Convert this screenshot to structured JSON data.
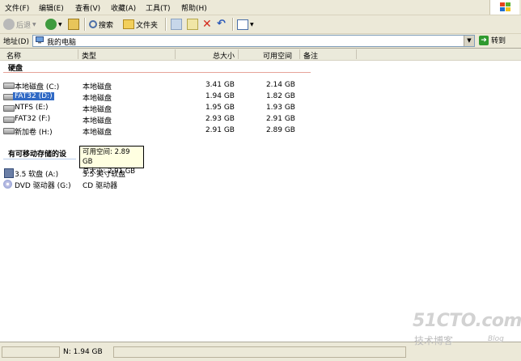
{
  "menubar": {
    "items": [
      "文件(F)",
      "编辑(E)",
      "查看(V)",
      "收藏(A)",
      "工具(T)",
      "帮助(H)"
    ]
  },
  "toolbar": {
    "back_label": "后退",
    "search_label": "搜索",
    "folders_label": "文件夹"
  },
  "address": {
    "label": "地址(D)",
    "value": "我的电脑",
    "go_label": "转到"
  },
  "columns": [
    "名称",
    "类型",
    "总大小",
    "可用空间",
    "备注"
  ],
  "groups": {
    "hard_disks": "硬盘",
    "removable": "有可移动存储的设"
  },
  "hard_disks": [
    {
      "name": "本地磁盘 (C:)",
      "type": "本地磁盘",
      "size": "3.41 GB",
      "free": "2.14 GB"
    },
    {
      "name": "FAT32 (D:)",
      "type": "本地磁盘",
      "size": "1.94 GB",
      "free": "1.82 GB",
      "selected": true
    },
    {
      "name": "NTFS (E:)",
      "type": "本地磁盘",
      "size": "1.95 GB",
      "free": "1.93 GB"
    },
    {
      "name": "FAT32 (F:)",
      "type": "本地磁盘",
      "size": "2.93 GB",
      "free": "2.91 GB"
    },
    {
      "name": "新加卷 (H:)",
      "type": "本地磁盘",
      "size": "2.91 GB",
      "free": "2.89 GB"
    }
  ],
  "removable_drives": [
    {
      "name": "3.5 软盘 (A:)",
      "type": "3.5 英寸软盘",
      "icon": "floppy-icon"
    },
    {
      "name": "DVD 驱动器 (G:)",
      "type": "CD 驱动器",
      "icon": "dvd-drive-icon"
    }
  ],
  "tooltip": {
    "line1": "可用空间: 2.89 GB",
    "line2": "总大小: 2.91 GB"
  },
  "statusbar": {
    "text": "N: 1.94 GB"
  },
  "watermark": {
    "logo": "51CTO.com",
    "sub": "技术博客",
    "blog": "Blog"
  },
  "colors": {
    "chrome": "#ece9d8",
    "selection": "#316ac5",
    "tooltip_bg": "#ffffe1"
  }
}
